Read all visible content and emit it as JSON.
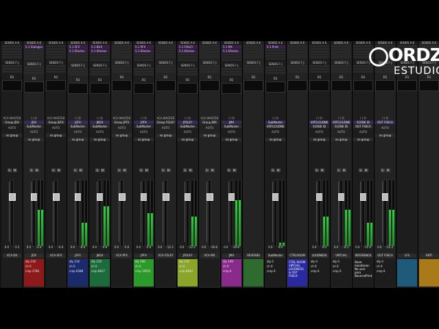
{
  "section_labels": {
    "sends_ae": "SENDS A-E",
    "sends_fj": "SENDS F-J",
    "eq": "EQ",
    "io": "I / O",
    "auto": "AUTO",
    "no_group": "no group"
  },
  "logo": {
    "line1": "ORDZ",
    "line2": "ESTUDIO"
  },
  "channels": [
    {
      "name": "VCA DX",
      "vca": "VCA MASTER",
      "out": "Group JDX",
      "auto": "AUTO",
      "group": "no group",
      "sends": [],
      "vals": [
        "0.0",
        "-3.5"
      ],
      "meter": 0,
      "color": "#1d1d1d"
    },
    {
      "name": "JDX",
      "vca": "",
      "io_in": "JDX",
      "io_out": "SubMaster",
      "auto": "AUTO",
      "group": "no group",
      "sends": [
        "5.1 Dialogos"
      ],
      "vals": [
        "0.0",
        "-3.4"
      ],
      "meter": 0.55,
      "color": "#8c1a1a",
      "stats": [
        "dly 219",
        "ch 0",
        "cmp 2780"
      ]
    },
    {
      "name": "VCA SFX",
      "vca": "VCA MASTER",
      "out": "Group JSFX",
      "auto": "AUTO",
      "group": "no group",
      "sends": [],
      "vals": [
        "0.0",
        "-6.0"
      ],
      "meter": 0,
      "color": "#1d1d1d"
    },
    {
      "name": "JSFX",
      "vca": "",
      "io_in": "JSFX",
      "io_out": "SubMaster",
      "auto": "AUTO",
      "group": "no group",
      "sends": [
        "5.1 SFX",
        "5.1 Efectos"
      ],
      "vals": [
        "0.0",
        "-6.0"
      ],
      "meter": 0.35,
      "color": "#1a2a6a",
      "stats": [
        "dly 219",
        "ch 0",
        "cmp 6588"
      ]
    },
    {
      "name": "JBGX",
      "vca": "",
      "io_in": "JBGX",
      "io_out": "SubMaster",
      "auto": "AUTO",
      "group": "no group",
      "sends": [
        "5.1 BGX",
        "5.1 Efectos"
      ],
      "vals": [
        "0.0",
        "-4.8"
      ],
      "meter": 0.6,
      "color": "#1d6a3a",
      "stats": [
        "dly 219",
        "ch 0",
        "cmp 8627"
      ]
    },
    {
      "name": "VCA PFX",
      "vca": "VCA MASTER",
      "out": "Group JPFX",
      "auto": "AUTO",
      "group": "no group",
      "sends": [],
      "vals": [
        "0.0",
        "-5.6"
      ],
      "meter": 0,
      "color": "#1d1d1d"
    },
    {
      "name": "JPFX",
      "vca": "",
      "io_in": "JPFX",
      "io_out": "SubMaster",
      "auto": "AUTO",
      "group": "no group",
      "sends": [
        "5.1 PFX",
        "5.1 Efectos"
      ],
      "vals": [
        "0.0",
        "-5.0"
      ],
      "meter": 0.5,
      "color": "#2b9a2b",
      "stats": [
        "dly 180",
        "ch 0",
        "cmp 10055"
      ]
    },
    {
      "name": "VCA FOLEY",
      "vca": "VCA MASTER",
      "out": "Group FOLEY",
      "auto": "AUTO",
      "group": "no group",
      "sends": [],
      "vals": [
        "0.0",
        "-12.2"
      ],
      "meter": 0,
      "color": "#1d1d1d"
    },
    {
      "name": "JFOLEY",
      "vca": "",
      "io_in": "JFOLEY",
      "io_out": "SubMaster",
      "auto": "AUTO",
      "group": "no group",
      "sends": [
        "5.1 FOLEY",
        "5.1 Efectos"
      ],
      "vals": [
        "0.0",
        "-12.2"
      ],
      "meter": 0.45,
      "color": "#8aa52a",
      "stats": [
        "dly 219",
        "ch 0",
        "cmp 8642"
      ]
    },
    {
      "name": "VCA MX",
      "vca": "VCA MASTER",
      "out": "Group JMX",
      "auto": "AUTO",
      "group": "no group",
      "sends": [],
      "vals": [
        "0.0",
        "-16.8"
      ],
      "meter": 0,
      "color": "#1d1d1d"
    },
    {
      "name": "JMX",
      "vca": "",
      "io_in": "JMX",
      "io_out": "SubMaster",
      "auto": "AUTO",
      "group": "no group",
      "sends": [
        "5.1 MX",
        "5.1 Efectos"
      ],
      "vals": [
        "0.0",
        "-16.8"
      ],
      "meter": 0.7,
      "color": "#8a2a8a",
      "stats": [
        "dly 199",
        "ch 0",
        "cmp 0"
      ]
    },
    {
      "name": "REVERBS",
      "vca": "",
      "io_in": "",
      "io_out": "",
      "auto": "",
      "group": "",
      "sends": [],
      "vals": [
        "",
        ""
      ],
      "meter": 0,
      "color": "#2f6a2f"
    },
    {
      "name": "SubMaster",
      "vca": "",
      "io_in": "SubMaster",
      "io_out": "VIRTLOUDNE",
      "auto": "AUTO",
      "group": "no group",
      "sends": [
        "5.1 Print"
      ],
      "vals": [
        "0.0",
        "0.0"
      ],
      "meter": 0.05,
      "color": "#1d1d1d",
      "stats": [
        "dly 0",
        "ch 0",
        "cmp 0"
      ]
    },
    {
      "name": "CTRLROOM",
      "vca": "",
      "io_in": "",
      "io_out": "",
      "auto": "",
      "group": "",
      "sends": [],
      "vals": [
        "",
        ""
      ],
      "meter": 0,
      "color": "#2a2aa0",
      "note": "CTRL ROOM VIRTUAL LOUDNESS & OUT FISICA"
    },
    {
      "name": "LOUDNESS",
      "vca": "",
      "io_in": "VIRTLOUDNE",
      "io_out": "SCENE ID",
      "auto": "AUTO",
      "group": "no group",
      "sends": [],
      "vals": [
        "0.0",
        "0.0"
      ],
      "meter": 0.45,
      "color": "#1d1d1d",
      "stats": [
        "dly 0",
        "ch 0",
        "cmp 0"
      ]
    },
    {
      "name": "VIRTUAL",
      "vca": "",
      "io_in": "VIRTLOUDNE",
      "io_out": "SCENE ID",
      "auto": "AUTO",
      "group": "no group",
      "sends": [],
      "vals": [
        "0.0",
        "-0.1"
      ],
      "meter": 0.55,
      "color": "#1d1d1d",
      "stats": [
        "dly 0",
        "ch 0",
        "cmp 0"
      ]
    },
    {
      "name": "REFERENCE",
      "vca": "",
      "io_in": "SCENE ID",
      "io_out": "OUT FISICA",
      "auto": "AUTO",
      "group": "no group",
      "sends": [],
      "vals": [
        "0.0",
        "-11.9"
      ],
      "meter": 0.35,
      "color": "#1d1d1d",
      "note": "Stem monitoreo: No usar para Bounce/Print"
    },
    {
      "name": "OUT FISICA",
      "vca": "",
      "io_in": "OUT FISICA",
      "io_out": "",
      "auto": "AUTO",
      "group": "no group",
      "sends": [],
      "vals": [
        "0.0",
        "-11.3"
      ],
      "meter": 0.55,
      "color": "#1d1d1d",
      "stats": [
        "dly 0",
        "ch 0",
        "cmp 0"
      ]
    },
    {
      "name": "LFS",
      "vca": "",
      "io_in": "",
      "io_out": "",
      "auto": "",
      "group": "",
      "sends": [],
      "vals": [
        "",
        ""
      ],
      "meter": 0,
      "color": "#1f5a7a"
    },
    {
      "name": "ENTI",
      "vca": "",
      "io_in": "",
      "io_out": "",
      "auto": "",
      "group": "",
      "sends": [],
      "vals": [
        "",
        ""
      ],
      "meter": 0,
      "color": "#a87a1a"
    }
  ]
}
